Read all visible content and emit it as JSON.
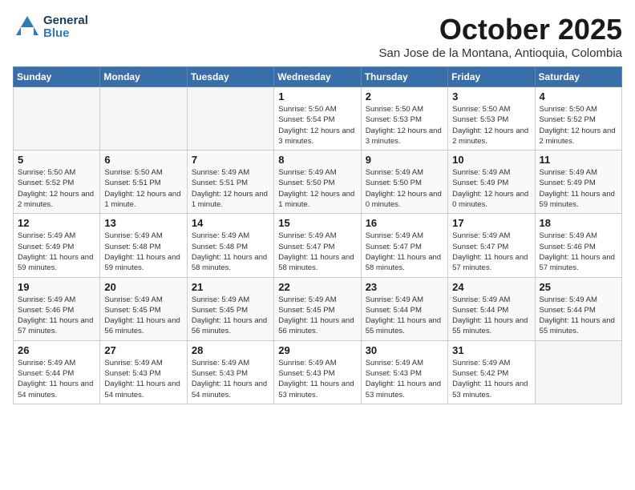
{
  "logo": {
    "general": "General",
    "blue": "Blue"
  },
  "title": "October 2025",
  "location": "San Jose de la Montana, Antioquia, Colombia",
  "days_of_week": [
    "Sunday",
    "Monday",
    "Tuesday",
    "Wednesday",
    "Thursday",
    "Friday",
    "Saturday"
  ],
  "weeks": [
    [
      {
        "day": "",
        "info": ""
      },
      {
        "day": "",
        "info": ""
      },
      {
        "day": "",
        "info": ""
      },
      {
        "day": "1",
        "info": "Sunrise: 5:50 AM\nSunset: 5:54 PM\nDaylight: 12 hours and 3 minutes."
      },
      {
        "day": "2",
        "info": "Sunrise: 5:50 AM\nSunset: 5:53 PM\nDaylight: 12 hours and 3 minutes."
      },
      {
        "day": "3",
        "info": "Sunrise: 5:50 AM\nSunset: 5:53 PM\nDaylight: 12 hours and 2 minutes."
      },
      {
        "day": "4",
        "info": "Sunrise: 5:50 AM\nSunset: 5:52 PM\nDaylight: 12 hours and 2 minutes."
      }
    ],
    [
      {
        "day": "5",
        "info": "Sunrise: 5:50 AM\nSunset: 5:52 PM\nDaylight: 12 hours and 2 minutes."
      },
      {
        "day": "6",
        "info": "Sunrise: 5:50 AM\nSunset: 5:51 PM\nDaylight: 12 hours and 1 minute."
      },
      {
        "day": "7",
        "info": "Sunrise: 5:49 AM\nSunset: 5:51 PM\nDaylight: 12 hours and 1 minute."
      },
      {
        "day": "8",
        "info": "Sunrise: 5:49 AM\nSunset: 5:50 PM\nDaylight: 12 hours and 1 minute."
      },
      {
        "day": "9",
        "info": "Sunrise: 5:49 AM\nSunset: 5:50 PM\nDaylight: 12 hours and 0 minutes."
      },
      {
        "day": "10",
        "info": "Sunrise: 5:49 AM\nSunset: 5:49 PM\nDaylight: 12 hours and 0 minutes."
      },
      {
        "day": "11",
        "info": "Sunrise: 5:49 AM\nSunset: 5:49 PM\nDaylight: 11 hours and 59 minutes."
      }
    ],
    [
      {
        "day": "12",
        "info": "Sunrise: 5:49 AM\nSunset: 5:49 PM\nDaylight: 11 hours and 59 minutes."
      },
      {
        "day": "13",
        "info": "Sunrise: 5:49 AM\nSunset: 5:48 PM\nDaylight: 11 hours and 59 minutes."
      },
      {
        "day": "14",
        "info": "Sunrise: 5:49 AM\nSunset: 5:48 PM\nDaylight: 11 hours and 58 minutes."
      },
      {
        "day": "15",
        "info": "Sunrise: 5:49 AM\nSunset: 5:47 PM\nDaylight: 11 hours and 58 minutes."
      },
      {
        "day": "16",
        "info": "Sunrise: 5:49 AM\nSunset: 5:47 PM\nDaylight: 11 hours and 58 minutes."
      },
      {
        "day": "17",
        "info": "Sunrise: 5:49 AM\nSunset: 5:47 PM\nDaylight: 11 hours and 57 minutes."
      },
      {
        "day": "18",
        "info": "Sunrise: 5:49 AM\nSunset: 5:46 PM\nDaylight: 11 hours and 57 minutes."
      }
    ],
    [
      {
        "day": "19",
        "info": "Sunrise: 5:49 AM\nSunset: 5:46 PM\nDaylight: 11 hours and 57 minutes."
      },
      {
        "day": "20",
        "info": "Sunrise: 5:49 AM\nSunset: 5:45 PM\nDaylight: 11 hours and 56 minutes."
      },
      {
        "day": "21",
        "info": "Sunrise: 5:49 AM\nSunset: 5:45 PM\nDaylight: 11 hours and 56 minutes."
      },
      {
        "day": "22",
        "info": "Sunrise: 5:49 AM\nSunset: 5:45 PM\nDaylight: 11 hours and 56 minutes."
      },
      {
        "day": "23",
        "info": "Sunrise: 5:49 AM\nSunset: 5:44 PM\nDaylight: 11 hours and 55 minutes."
      },
      {
        "day": "24",
        "info": "Sunrise: 5:49 AM\nSunset: 5:44 PM\nDaylight: 11 hours and 55 minutes."
      },
      {
        "day": "25",
        "info": "Sunrise: 5:49 AM\nSunset: 5:44 PM\nDaylight: 11 hours and 55 minutes."
      }
    ],
    [
      {
        "day": "26",
        "info": "Sunrise: 5:49 AM\nSunset: 5:44 PM\nDaylight: 11 hours and 54 minutes."
      },
      {
        "day": "27",
        "info": "Sunrise: 5:49 AM\nSunset: 5:43 PM\nDaylight: 11 hours and 54 minutes."
      },
      {
        "day": "28",
        "info": "Sunrise: 5:49 AM\nSunset: 5:43 PM\nDaylight: 11 hours and 54 minutes."
      },
      {
        "day": "29",
        "info": "Sunrise: 5:49 AM\nSunset: 5:43 PM\nDaylight: 11 hours and 53 minutes."
      },
      {
        "day": "30",
        "info": "Sunrise: 5:49 AM\nSunset: 5:43 PM\nDaylight: 11 hours and 53 minutes."
      },
      {
        "day": "31",
        "info": "Sunrise: 5:49 AM\nSunset: 5:42 PM\nDaylight: 11 hours and 53 minutes."
      },
      {
        "day": "",
        "info": ""
      }
    ]
  ]
}
